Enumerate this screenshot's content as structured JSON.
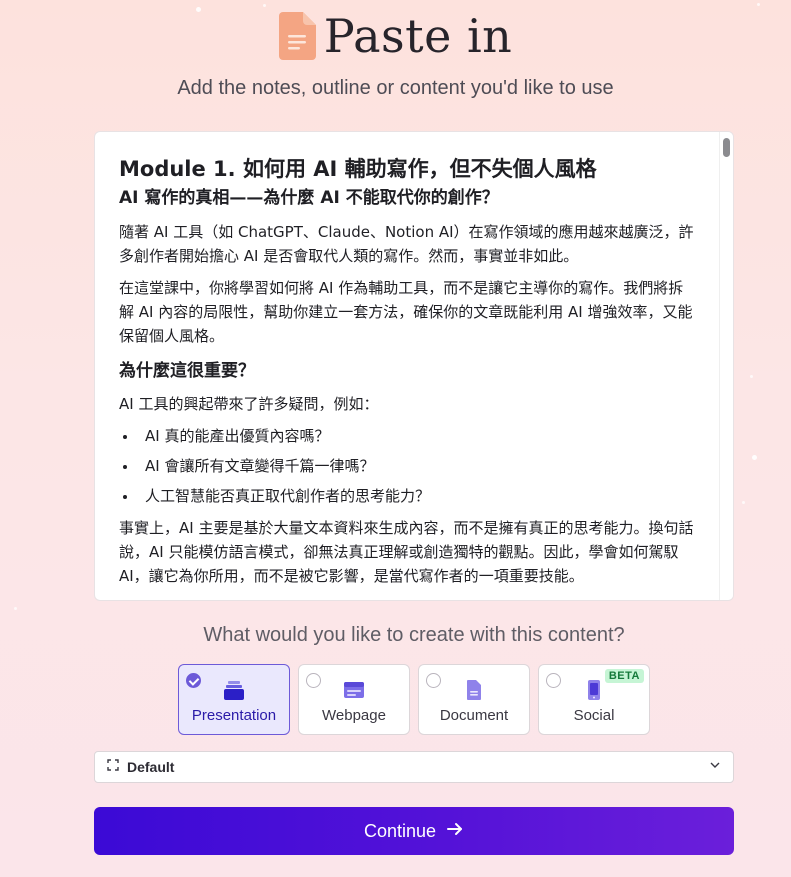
{
  "header": {
    "title": "Paste in",
    "subtitle": "Add the notes, outline or content you'd like to use"
  },
  "editor": {
    "heading1": "Module 1. 如何用 AI 輔助寫作，但不失個人風格",
    "heading2": "AI 寫作的真相——為什麼 AI 不能取代你的創作？",
    "paragraphs": [
      "隨著 AI 工具（如 ChatGPT、Claude、Notion AI）在寫作領域的應用越來越廣泛，許多創作者開始擔心 AI 是否會取代人類的寫作。然而，事實並非如此。",
      "在這堂課中，你將學習如何將 AI 作為輔助工具，而不是讓它主導你的寫作。我們將拆解 AI 內容的局限性，幫助你建立一套方法，確保你的文章既能利用 AI 增強效率，又能保留個人風格。"
    ],
    "heading3": "為什麼這很重要？",
    "intro": "AI 工具的興起帶來了許多疑問，例如：",
    "bullets": [
      "AI 真的能產出優質內容嗎？",
      "AI 會讓所有文章變得千篇一律嗎？",
      "人工智慧能否真正取代創作者的思考能力？"
    ],
    "closing": "事實上，AI 主要是基於大量文本資料來生成內容，而不是擁有真正的思考能力。換句話說，AI 只能模仿語言模式，卻無法真正理解或創造獨特的觀點。因此，學會如何駕馭 AI，讓它為你所用，而不是被它影響，是當代寫作者的一項重要技能。"
  },
  "create": {
    "question": "What would you like to create with this content?",
    "options": [
      {
        "label": "Presentation",
        "icon": "presentation-stack-icon",
        "selected": true
      },
      {
        "label": "Webpage",
        "icon": "browser-window-icon",
        "selected": false
      },
      {
        "label": "Document",
        "icon": "document-icon",
        "selected": false
      },
      {
        "label": "Social",
        "icon": "phone-icon",
        "selected": false,
        "badge": "BETA"
      }
    ]
  },
  "theme": {
    "label": "Default",
    "icon": "expand-frame-icon"
  },
  "continue": {
    "label": "Continue",
    "icon": "arrow-right-icon"
  },
  "colors": {
    "accent": "#5412d8",
    "selected_bg": "#eae8fd",
    "icon_orange": "#f4a583",
    "beta_bg": "#c6f5d5"
  }
}
